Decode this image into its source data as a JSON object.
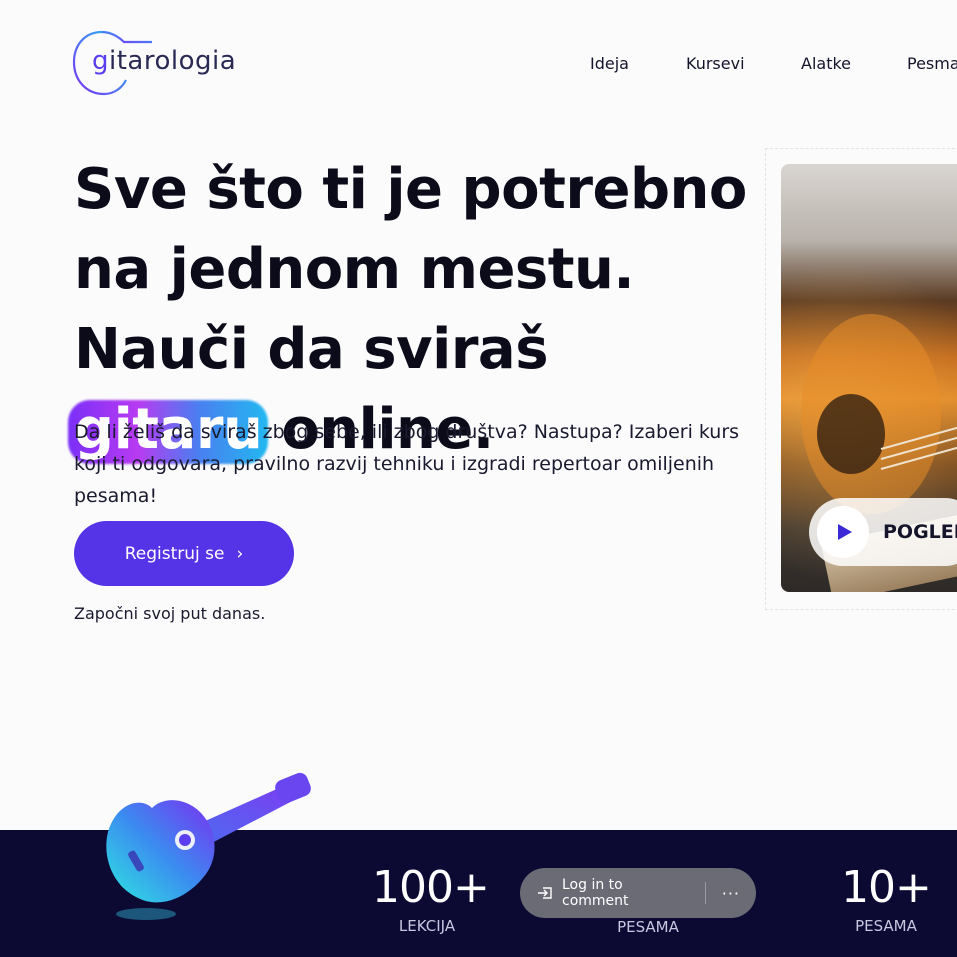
{
  "brand": {
    "logo_text_first": "g",
    "logo_text_rest": "itarologia"
  },
  "nav": {
    "items": [
      "Ideja",
      "Kursevi",
      "Alatke",
      "Pesma"
    ]
  },
  "hero": {
    "title_part1": "Sve što ti je potrebno na jednom mestu. Nauči da sviraš ",
    "title_highlight": "gitaru",
    "title_part2": " online.",
    "subtitle": "Da li želiš da sviraš zbog sebe, ili zbog društva? Nastupa? Izaberi kurs koji ti odgovara, pravilno razvij tehniku i izgradi repertoar omiljenih pesama!",
    "cta_label": "Registruj se",
    "cta_chevron": "›",
    "cta_note": "Započni svoj put danas."
  },
  "video": {
    "watch_label": "POGLED"
  },
  "stats": [
    {
      "num": "100+",
      "label": "LEKCIJA"
    },
    {
      "num": "",
      "label": "PESAMA"
    },
    {
      "num": "10+",
      "label": "PESAMA"
    }
  ],
  "comment_bar": {
    "login_label": "Log in to comment",
    "more_label": "···"
  },
  "colors": {
    "primary": "#5533e6",
    "dark_band": "#0c0a33",
    "text": "#0b0b1a"
  }
}
